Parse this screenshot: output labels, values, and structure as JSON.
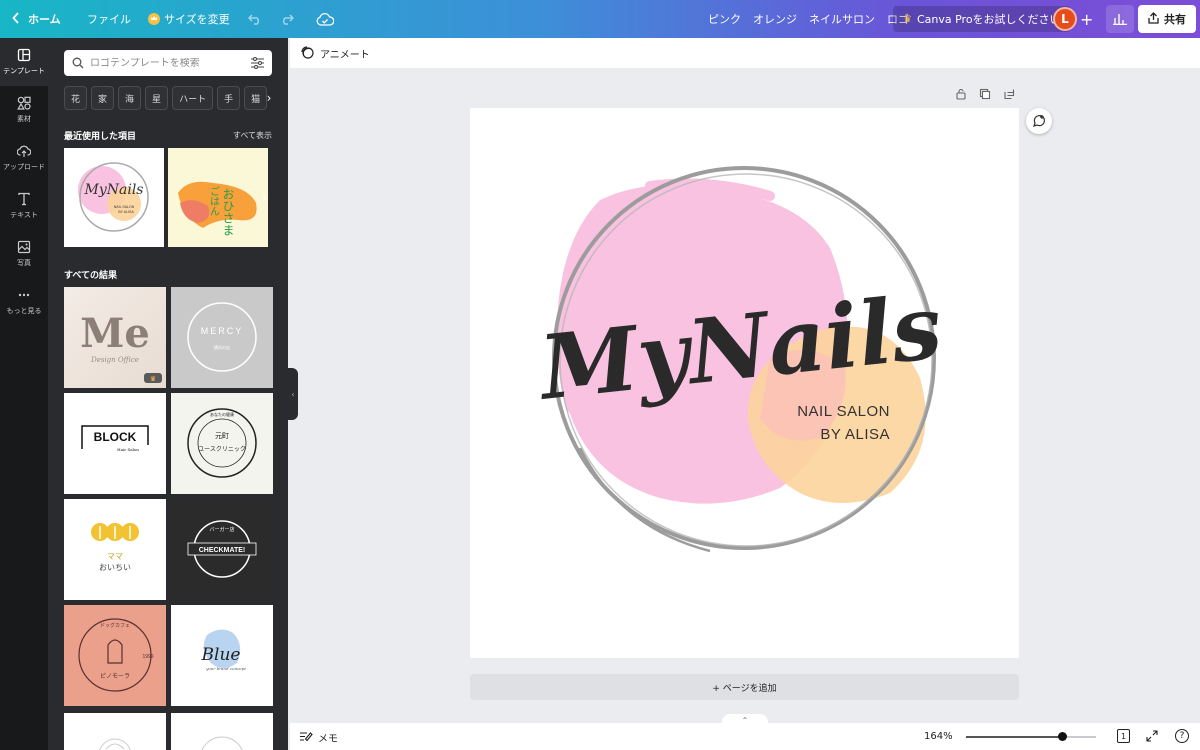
{
  "topbar": {
    "home": "ホーム",
    "file": "ファイル",
    "resize": "サイズを変更",
    "tags": [
      "ピンク",
      "オレンジ",
      "ネイルサロン",
      "ロゴ"
    ],
    "pro_trial": "Canva Proをお試しください",
    "avatar": "L",
    "share": "共有",
    "accent": "#7c4dd6"
  },
  "rail": [
    {
      "label": "テンプレート",
      "icon": "template-icon",
      "active": true
    },
    {
      "label": "素材",
      "icon": "elements-icon"
    },
    {
      "label": "アップロード",
      "icon": "upload-icon"
    },
    {
      "label": "テキスト",
      "icon": "text-icon"
    },
    {
      "label": "写真",
      "icon": "photo-icon"
    },
    {
      "label": "もっと見る",
      "icon": "more-icon"
    }
  ],
  "panel": {
    "search_placeholder": "ロゴテンプレートを検索",
    "chips": [
      "花",
      "家",
      "海",
      "星",
      "ハート",
      "手",
      "猫"
    ],
    "recent_title": "最近使用した項目",
    "see_all": "すべて表示",
    "all_results_title": "すべての結果",
    "recent": [
      {
        "title": "MyNails",
        "line1": "NAIL SALON",
        "line2": "BY ALISA"
      },
      {
        "title": "おひさま",
        "line1": "ごはん"
      }
    ],
    "templates": [
      {
        "title": "Me",
        "subtitle": "Design Office",
        "premium": true
      },
      {
        "title": "MERCY",
        "subtitle": "横浜の店"
      },
      {
        "title": "BLOCK",
        "subtitle": "Hair Salon"
      },
      {
        "title": "元町",
        "subtitle": "ユースクリニック",
        "ring_text": "あなたの健康"
      },
      {
        "title": "ママ",
        "subtitle": "おいちい"
      },
      {
        "title": "CHECKMATE!",
        "ring_text": "バーガー店"
      },
      {
        "title": "ピノモーラ",
        "subtitle": "1999",
        "ring_text": "ドッグカフェ"
      },
      {
        "title": "Blue",
        "subtitle": "your brand concept"
      }
    ]
  },
  "editor": {
    "animate": "アニメート",
    "add_page": "+ ページを追加",
    "memo": "メモ",
    "zoom": "164%",
    "zoom_level": 0.74,
    "page_number": "1"
  },
  "design": {
    "title": "MyNails",
    "line1": "NAIL SALON",
    "line2": "BY ALISA",
    "colors": {
      "pink": "#f9c2e0",
      "orange": "#fcd39a",
      "ring": "#9c9c9c",
      "text": "#2a2a2a"
    }
  }
}
